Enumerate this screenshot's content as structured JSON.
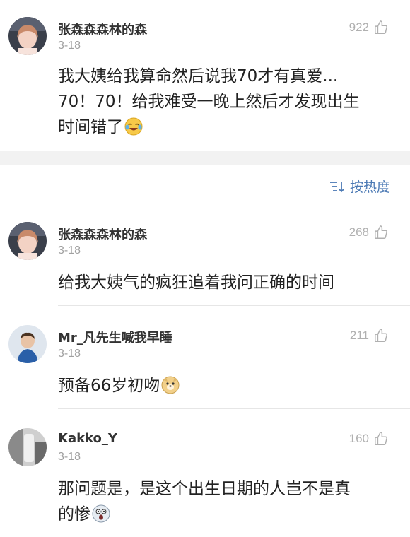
{
  "top_comment": {
    "username": "张森森森林的森",
    "date": "3-18",
    "likes": "922",
    "text_lines": [
      "我大姨给我算命然后说我70才有真爱...",
      "70！70！给我难受一晚上然后才发现出生",
      "时间错了"
    ],
    "emoji": "laugh-cry-emoji"
  },
  "sort": {
    "label": "按热度",
    "icon": "sort-icon"
  },
  "replies": [
    {
      "username": "张森森森林的森",
      "date": "3-18",
      "likes": "268",
      "text_lines": [
        "给我大姨气的疯狂追着我问正确的时间"
      ]
    },
    {
      "username": "Mr_凡先生喊我早睡",
      "date": "3-18",
      "likes": "211",
      "text_lines": [
        "预备66岁初吻"
      ],
      "emoji": "doge-emoji"
    },
    {
      "username": "Kakko_Y",
      "date": "3-18",
      "likes": "160",
      "text_lines": [
        "那问题是，是这个出生日期的人岂不是真",
        "的惨"
      ],
      "emoji": "scared-emoji"
    }
  ],
  "colors": {
    "accent": "#4b79b4",
    "muted": "#a0a0a0",
    "separator": "#f2f2f2"
  }
}
